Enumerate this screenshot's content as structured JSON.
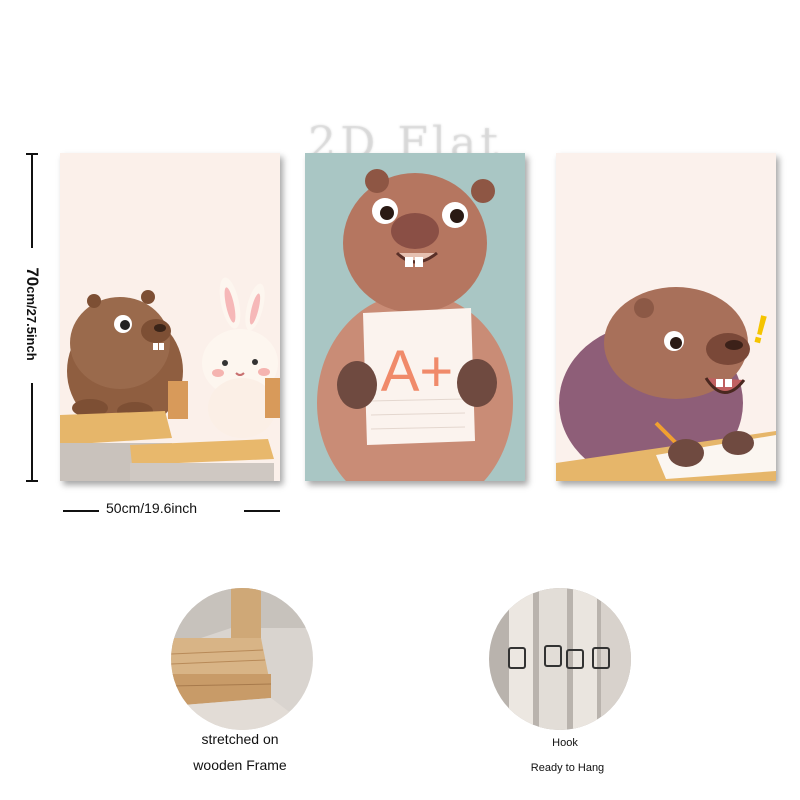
{
  "watermark": "2D Flat",
  "dimensions": {
    "height_value": "70",
    "height_unit": "cm/27.5inch",
    "width_label": "50cm/19.6inch"
  },
  "panels": [
    {
      "name": "capybara and rabbit at desks"
    },
    {
      "name": "capybara holding A+ paper",
      "paper_text": "A+"
    },
    {
      "name": "capybara writing with exclamation",
      "exclaim_mark": "!"
    }
  ],
  "features": {
    "frame": {
      "line1": "stretched on",
      "line2": "wooden Frame"
    },
    "hook": {
      "line1": "Hook",
      "line2": "Ready to Hang"
    }
  },
  "colors": {
    "capybara_brown": "#9a6a4c",
    "paper_text": "#f08a6a",
    "exclaim": "#f5c400",
    "teal_background": "#a9c6c4"
  }
}
